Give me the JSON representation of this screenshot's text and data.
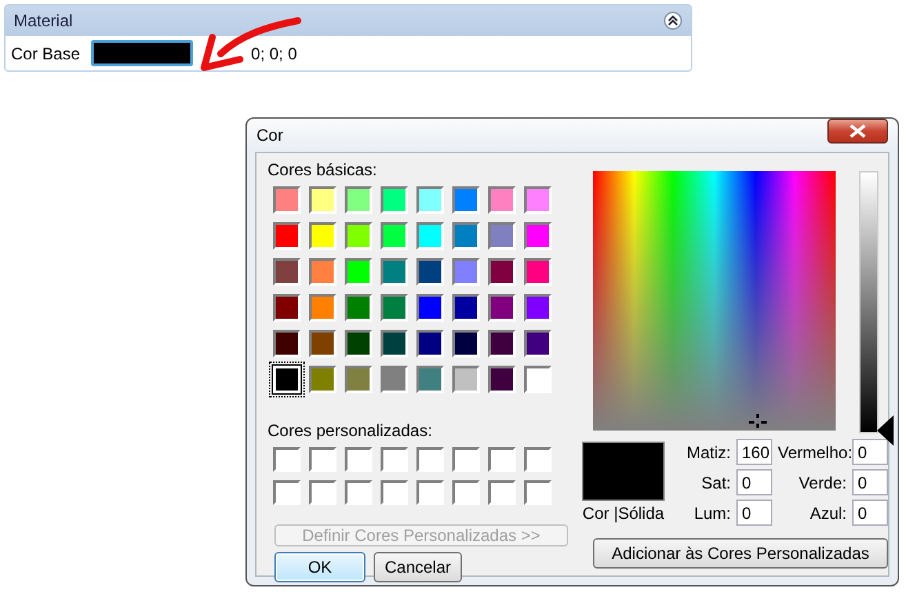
{
  "panel": {
    "title": "Material",
    "expanded": true,
    "fields": [
      {
        "label": "Cor Base",
        "color": "#000000",
        "value": "0; 0; 0"
      }
    ]
  },
  "dialog": {
    "title": "Cor",
    "basic_label": "Cores básicas:",
    "basic_colors": [
      {
        "color": "#ff8080",
        "selected": false
      },
      {
        "color": "#ffff80",
        "selected": false
      },
      {
        "color": "#80ff80",
        "selected": false
      },
      {
        "color": "#00ff80",
        "selected": false
      },
      {
        "color": "#80ffff",
        "selected": false
      },
      {
        "color": "#0080ff",
        "selected": false
      },
      {
        "color": "#ff80c0",
        "selected": false
      },
      {
        "color": "#ff80ff",
        "selected": false
      },
      {
        "color": "#ff0000",
        "selected": false
      },
      {
        "color": "#ffff00",
        "selected": false
      },
      {
        "color": "#80ff00",
        "selected": false
      },
      {
        "color": "#00ff40",
        "selected": false
      },
      {
        "color": "#00ffff",
        "selected": false
      },
      {
        "color": "#0080c0",
        "selected": false
      },
      {
        "color": "#8080c0",
        "selected": false
      },
      {
        "color": "#ff00ff",
        "selected": false
      },
      {
        "color": "#804040",
        "selected": false
      },
      {
        "color": "#ff8040",
        "selected": false
      },
      {
        "color": "#00ff00",
        "selected": false
      },
      {
        "color": "#008080",
        "selected": false
      },
      {
        "color": "#004080",
        "selected": false
      },
      {
        "color": "#8080ff",
        "selected": false
      },
      {
        "color": "#800040",
        "selected": false
      },
      {
        "color": "#ff0080",
        "selected": false
      },
      {
        "color": "#800000",
        "selected": false
      },
      {
        "color": "#ff8000",
        "selected": false
      },
      {
        "color": "#008000",
        "selected": false
      },
      {
        "color": "#008040",
        "selected": false
      },
      {
        "color": "#0000ff",
        "selected": false
      },
      {
        "color": "#0000a0",
        "selected": false
      },
      {
        "color": "#800080",
        "selected": false
      },
      {
        "color": "#8000ff",
        "selected": false
      },
      {
        "color": "#400000",
        "selected": false
      },
      {
        "color": "#804000",
        "selected": false
      },
      {
        "color": "#004000",
        "selected": false
      },
      {
        "color": "#004040",
        "selected": false
      },
      {
        "color": "#000080",
        "selected": false
      },
      {
        "color": "#000040",
        "selected": false
      },
      {
        "color": "#400040",
        "selected": false
      },
      {
        "color": "#400080",
        "selected": false
      },
      {
        "color": "#000000",
        "selected": true
      },
      {
        "color": "#808000",
        "selected": false
      },
      {
        "color": "#808040",
        "selected": false
      },
      {
        "color": "#808080",
        "selected": false
      },
      {
        "color": "#408080",
        "selected": false
      },
      {
        "color": "#c0c0c0",
        "selected": false
      },
      {
        "color": "#400040",
        "selected": false
      },
      {
        "color": "#ffffff",
        "selected": false
      }
    ],
    "custom_label": "Cores personalizadas:",
    "custom_colors": [
      {
        "color": "#ffffff"
      },
      {
        "color": "#ffffff"
      },
      {
        "color": "#ffffff"
      },
      {
        "color": "#ffffff"
      },
      {
        "color": "#ffffff"
      },
      {
        "color": "#ffffff"
      },
      {
        "color": "#ffffff"
      },
      {
        "color": "#ffffff"
      },
      {
        "color": "#ffffff"
      },
      {
        "color": "#ffffff"
      },
      {
        "color": "#ffffff"
      },
      {
        "color": "#ffffff"
      },
      {
        "color": "#ffffff"
      },
      {
        "color": "#ffffff"
      },
      {
        "color": "#ffffff"
      },
      {
        "color": "#ffffff"
      }
    ],
    "define_button": {
      "label": "Definir Cores Personalizadas >>",
      "disabled": true
    },
    "ok_button": "OK",
    "cancel_button": "Cancelar",
    "luminance": {
      "level": 0
    },
    "preview": {
      "color": "#000000",
      "label": "Cor |Sólida"
    },
    "fields": [
      {
        "label": "Matiz:",
        "value": "160"
      },
      {
        "label": "Vermelho:",
        "value": "0"
      },
      {
        "label": "Sat:",
        "value": "0"
      },
      {
        "label": "Verde:",
        "value": "0"
      },
      {
        "label": "Lum:",
        "value": "0"
      },
      {
        "label": "Azul:",
        "value": "0"
      }
    ],
    "add_button": "Adicionar às Cores Personalizadas"
  }
}
